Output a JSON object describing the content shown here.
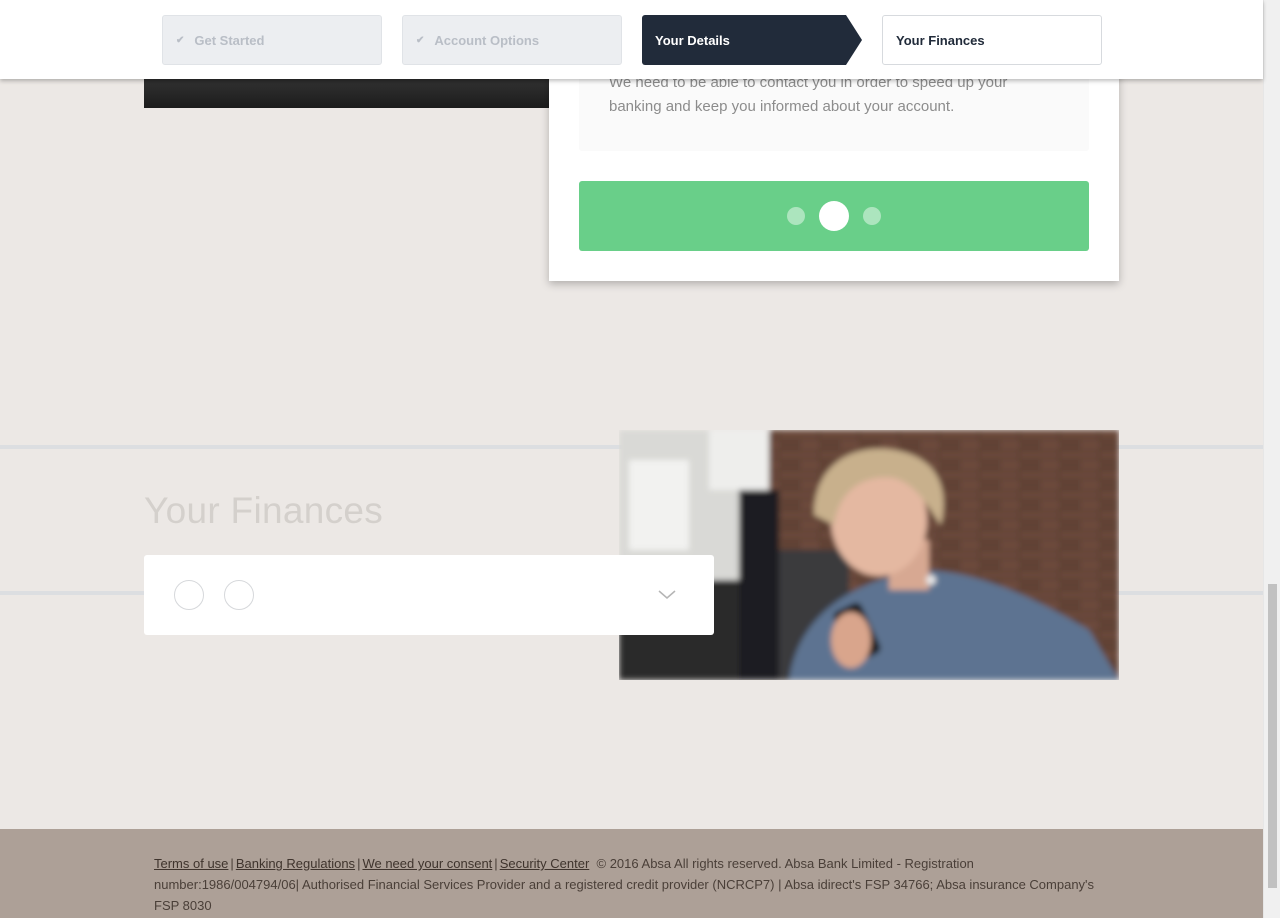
{
  "steps": [
    {
      "label": "Get Started",
      "state": "done",
      "check": "✔"
    },
    {
      "label": "Account Options",
      "state": "done",
      "check": "✔"
    },
    {
      "label": "Your Details",
      "state": "active"
    },
    {
      "label": "Your Finances",
      "state": "todo"
    }
  ],
  "details": {
    "note": "We need to be able to contact you in order to speed up your banking and keep you informed about your account.",
    "progress": {
      "total_dots": 3,
      "active_index": 1
    }
  },
  "finances": {
    "title": "Your Finances",
    "radio_count": 2
  },
  "footer": {
    "links": [
      "Terms of use",
      "Banking Regulations",
      "We need your consent",
      "Security Center"
    ],
    "separator": "|",
    "legal": "© 2016 Absa All rights reserved. Absa Bank Limited - Registration number:1986/004794/06| Authorised Financial Services Provider and a registered credit provider (NCRCP7) | Absa idirect's FSP 34766; Absa insurance Company's FSP 8030"
  },
  "colors": {
    "active_step": "#212b3a",
    "progress_green": "#69cf89",
    "footer_bg": "#ada097",
    "page_bg": "#ece8e5"
  }
}
